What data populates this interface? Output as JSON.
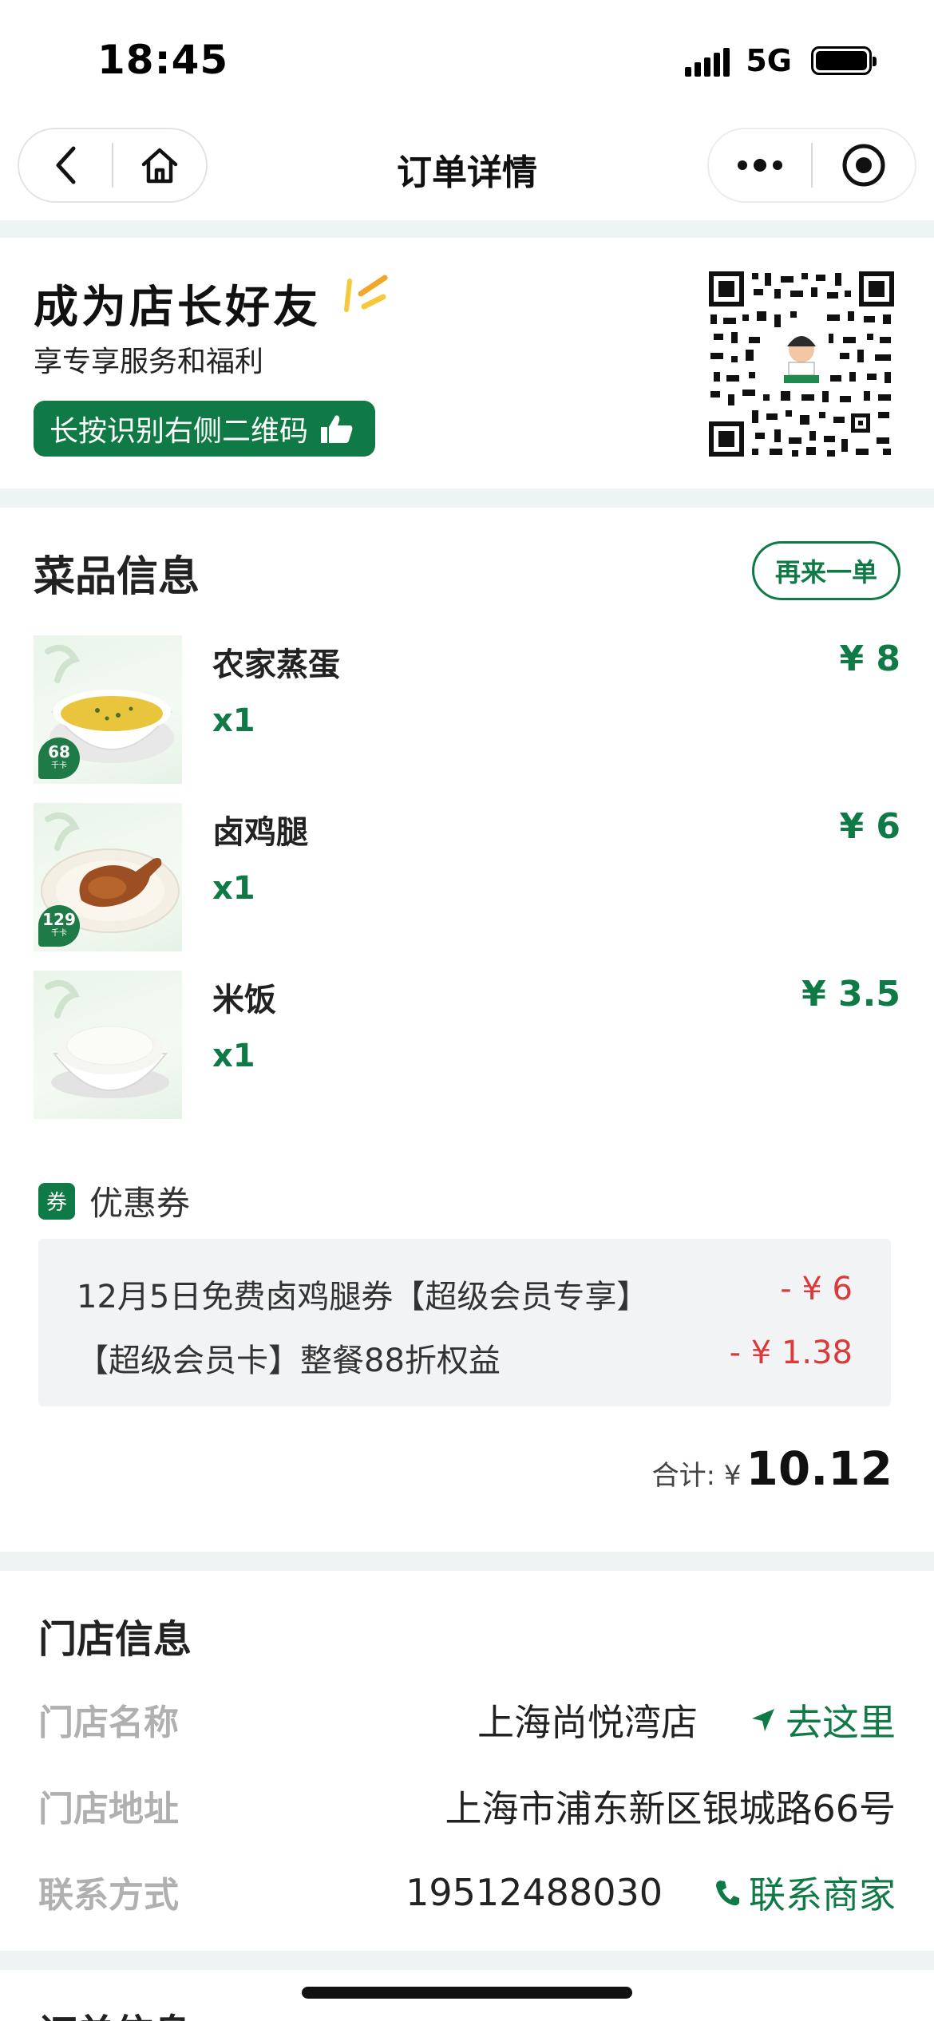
{
  "status_bar": {
    "time": "18:45",
    "network": "5G"
  },
  "nav": {
    "title": "订单详情"
  },
  "friend": {
    "title": "成为店长好友",
    "subtitle": "享专享服务和福利",
    "button_label": "长按识别右侧二维码"
  },
  "dishes": {
    "section_title": "菜品信息",
    "reorder_label": "再来一单",
    "items": [
      {
        "name": "农家蒸蛋",
        "qty": "x1",
        "price": "¥ 8",
        "kcal": "68",
        "kcal_unit": "千卡"
      },
      {
        "name": "卤鸡腿",
        "qty": "x1",
        "price": "¥ 6",
        "kcal": "129",
        "kcal_unit": "千卡"
      },
      {
        "name": "米饭",
        "qty": "x1",
        "price": "¥ 3.5"
      }
    ]
  },
  "coupons": {
    "tag": "券",
    "label": "优惠券",
    "items": [
      {
        "name": "12月5日免费卤鸡腿券【超级会员专享】",
        "amount": "- ¥ 6"
      },
      {
        "name": "【超级会员卡】整餐88折权益",
        "amount": "- ¥ 1.38"
      }
    ]
  },
  "total": {
    "label": "合计: ¥",
    "value": "10.12"
  },
  "store": {
    "section_title": "门店信息",
    "rows": [
      {
        "key": "门店名称",
        "value": "上海尚悦湾店",
        "action": "去这里"
      },
      {
        "key": "门店地址",
        "value": "上海市浦东新区银城路66号"
      },
      {
        "key": "联系方式",
        "value": "19512488030",
        "action": "联系商家"
      }
    ]
  },
  "order": {
    "section_title": "订单信息"
  },
  "colors": {
    "brand_green": "#0f7a45",
    "discount_red": "#d93a3a",
    "page_bg": "#eef3f3"
  },
  "icons": [
    "back-icon",
    "home-icon",
    "more-icon",
    "close-mini-program-icon",
    "thumbs-up-icon",
    "navigate-icon",
    "phone-icon"
  ]
}
